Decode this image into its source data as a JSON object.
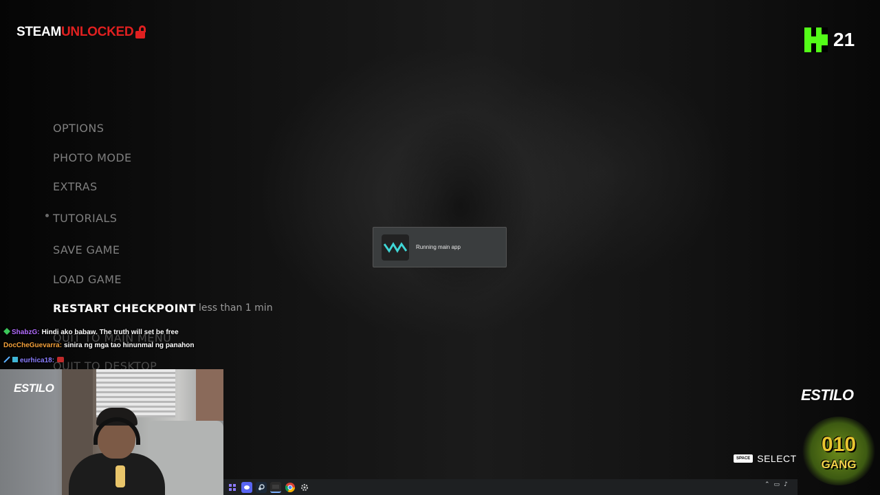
{
  "brand": {
    "part1": "STEAM",
    "part2": "UNLOCKED"
  },
  "kick": {
    "viewers": "21"
  },
  "menu": {
    "items": [
      {
        "label": "OPTIONS",
        "state": "normal"
      },
      {
        "label": "PHOTO MODE",
        "state": "normal"
      },
      {
        "label": "EXTRAS",
        "state": "normal"
      },
      {
        "label": "TUTORIALS",
        "state": "normal"
      },
      {
        "label": "SAVE GAME",
        "state": "normal"
      },
      {
        "label": "LOAD GAME",
        "state": "normal"
      },
      {
        "label": "RESTART CHECKPOINT",
        "state": "active"
      },
      {
        "label": "QUIT TO MAIN MENU",
        "state": "faded"
      },
      {
        "label": "QUIT TO DESKTOP",
        "state": "faded"
      }
    ],
    "checkpoint_time": "less than 1 min"
  },
  "toast": {
    "text": "Running main app",
    "logo": "VM"
  },
  "chat": [
    {
      "user": "ShabzG:",
      "user_color": "#b36cff",
      "message": "Hindi ako babaw. The truth will set be free"
    },
    {
      "user": "DocCheGuevarra:",
      "user_color": "#f3a03a",
      "message": "sinira ng mga tao hinunmal ng panahon"
    },
    {
      "user": "eurhica18:",
      "user_color": "#8a7dff",
      "message": ""
    }
  ],
  "webcam": {
    "overlay_logo": "ESTILO"
  },
  "overlay": {
    "brand": "ESTILO",
    "gang_top": "010",
    "gang_bottom": "GANG"
  },
  "select_hint": {
    "key": "SPACE",
    "label": "SELECT"
  },
  "taskbar": {
    "icons": [
      "grid-icon",
      "discord-icon",
      "steam-icon",
      "terminal-icon",
      "chrome-icon",
      "settings-icon"
    ]
  },
  "colors": {
    "kick_green": "#53fc18",
    "steam_red": "#e02020",
    "menu_active": "#ffffff",
    "menu_normal": "#7f7f7f"
  }
}
